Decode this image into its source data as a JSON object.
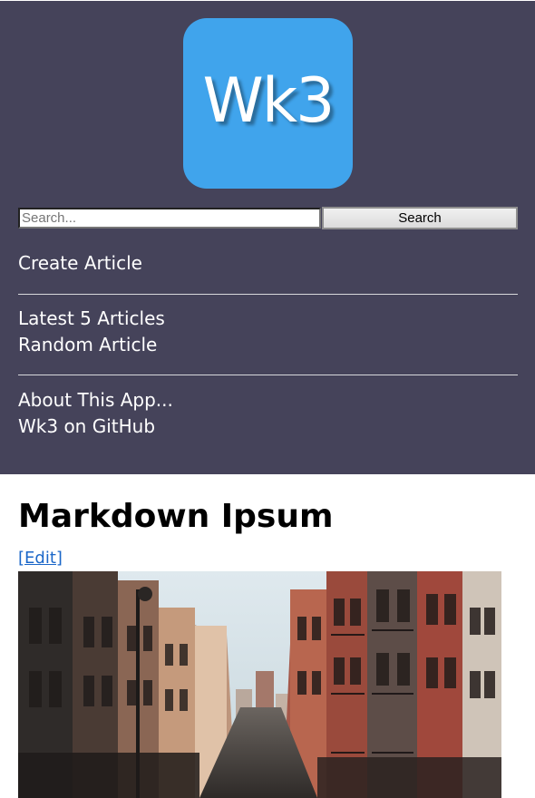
{
  "app": {
    "logo_text": "Wk3"
  },
  "search": {
    "placeholder": "Search...",
    "value": "",
    "button_label": "Search"
  },
  "nav": {
    "create_article": "Create Article",
    "latest_articles": "Latest 5 Articles",
    "random_article": "Random Article",
    "about_app": "About This App...",
    "github": "Wk3 on GitHub"
  },
  "article": {
    "title": "Markdown Ipsum",
    "edit_link": "[Edit]",
    "image_alt": "city street photo"
  },
  "colors": {
    "header_bg": "#45435a",
    "logo_bg": "#40a4ec",
    "link_blue": "#1a66c8"
  }
}
